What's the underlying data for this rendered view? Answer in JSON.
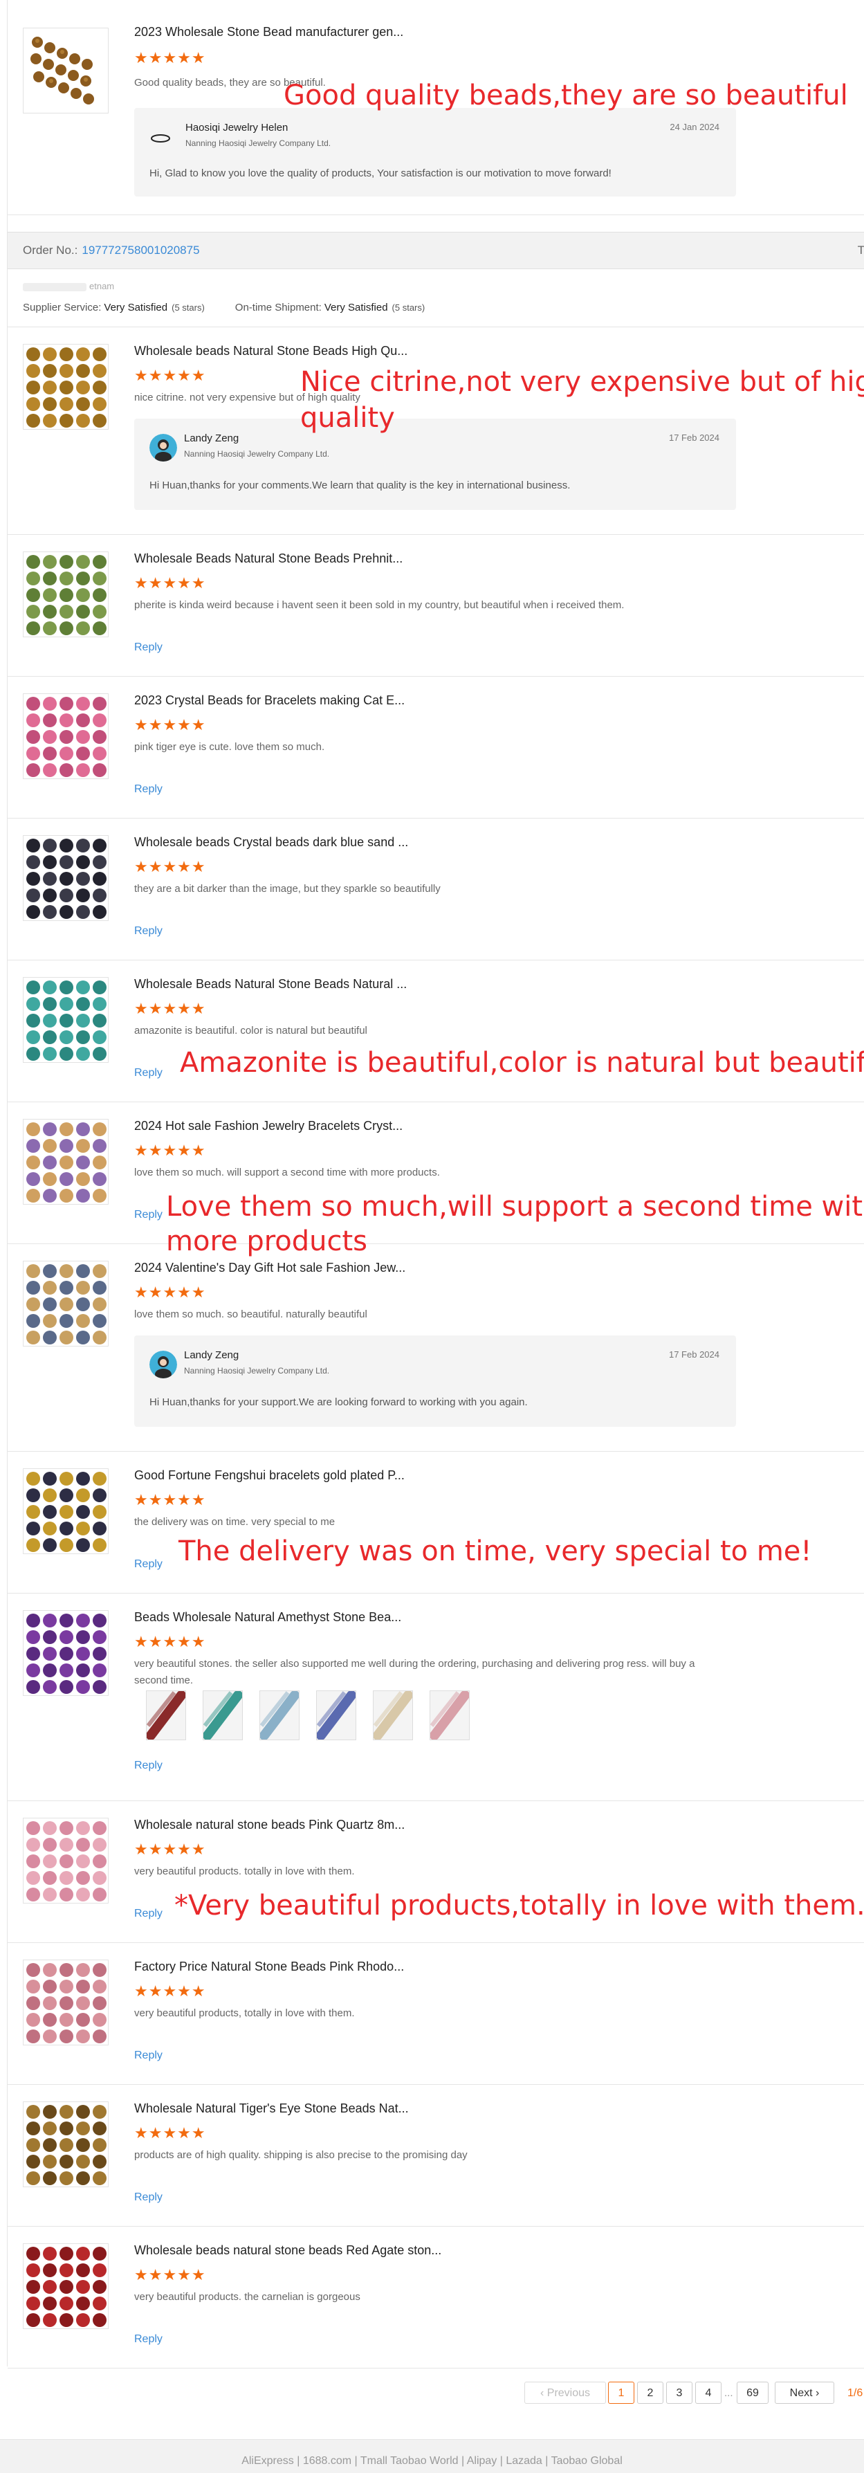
{
  "order1": {
    "item": {
      "title": "2023 Wholesale Stone Bead manufacturer gen...",
      "stars": "★★★★★",
      "comment": "Good quality beads, they are so beautiful.",
      "reply": {
        "name": "Haosiqi Jewelry Helen",
        "company": "Nanning Haosiqi Jewelry Company Ltd.",
        "date": "24 Jan 2024",
        "text": "Hi,  Glad to know you love the quality of products, Your satisfaction is our motivation to move forward!"
      }
    },
    "annotation": "Good quality beads,they are so beautiful"
  },
  "order2": {
    "order_no_label": "Order No.:",
    "order_no": "197772758001020875",
    "right_label": "T",
    "country": "etnam",
    "supplier_service_label": "Supplier Service:",
    "supplier_service_value": "Very Satisfied",
    "supplier_service_stars": "(5 stars)",
    "shipment_label": "On-time Shipment:",
    "shipment_value": "Very Satisfied",
    "shipment_stars": "(5 stars)"
  },
  "items": [
    {
      "title": "Wholesale beads Natural Stone Beads High Qu...",
      "stars": "★★★★★",
      "comment": "nice citrine. not very expensive but of high quality",
      "reply": {
        "name": "Landy Zeng",
        "company": "Nanning Haosiqi Jewelry Company Ltd.",
        "date": "17 Feb 2024",
        "text": "Hi Huan,thanks for your comments.We learn that quality is the key in international business."
      }
    },
    {
      "title": "Wholesale Beads Natural Stone Beads Prehnit...",
      "stars": "★★★★★",
      "comment": "pherite is kinda weird because i havent seen it been sold in my country, but beautiful when i received them.",
      "reply_label": "Reply"
    },
    {
      "title": "2023 Crystal Beads for Bracelets making Cat E...",
      "stars": "★★★★★",
      "comment": "pink tiger eye is cute. love them so much.",
      "reply_label": "Reply"
    },
    {
      "title": "Wholesale beads Crystal beads dark blue sand ...",
      "stars": "★★★★★",
      "comment": "they are a bit darker than the image, but they sparkle so beautifully",
      "reply_label": "Reply"
    },
    {
      "title": "Wholesale Beads Natural Stone Beads Natural ...",
      "stars": "★★★★★",
      "comment": "amazonite is beautiful. color is natural but beautiful",
      "reply_label": "Reply"
    },
    {
      "title": "2024 Hot sale Fashion Jewelry Bracelets Cryst...",
      "stars": "★★★★★",
      "comment": "love them so much. will support a second time with more products.",
      "reply_label": "Reply"
    },
    {
      "title": "2024 Valentine's Day Gift Hot sale Fashion Jew...",
      "stars": "★★★★★",
      "comment": "love them so much. so beautiful. naturally beautiful",
      "reply": {
        "name": "Landy Zeng",
        "company": "Nanning Haosiqi Jewelry Company Ltd.",
        "date": "17 Feb 2024",
        "text": "Hi Huan,thanks for your support.We are looking forward to working with you again."
      }
    },
    {
      "title": "Good Fortune Fengshui bracelets gold plated P...",
      "stars": "★★★★★",
      "comment": "the delivery was on time. very  special to me",
      "reply_label": "Reply"
    },
    {
      "title": "Beads Wholesale Natural Amethyst Stone Bea...",
      "stars": "★★★★★",
      "comment": "very beautiful stones. the seller also supported me well during the ordering, purchasing and delivering prog ress. will buy a second time.",
      "reply_label": "Reply"
    },
    {
      "title": "Wholesale natural stone beads Pink Quartz 8m...",
      "stars": "★★★★★",
      "comment": "very beautiful products. totally in love with them.",
      "reply_label": "Reply"
    },
    {
      "title": "Factory Price Natural Stone Beads Pink Rhodo...",
      "stars": "★★★★★",
      "comment": "very beautiful products, totally in love with them.",
      "reply_label": "Reply"
    },
    {
      "title": "Wholesale Natural Tiger's Eye Stone Beads Nat...",
      "stars": "★★★★★",
      "comment": "products are of high quality. shipping is also precise to the promising day",
      "reply_label": "Reply"
    },
    {
      "title": "Wholesale beads natural stone beads Red Agate ston...",
      "stars": "★★★★★",
      "comment": "very beautiful products. the carnelian is gorgeous",
      "reply_label": "Reply"
    }
  ],
  "annotations": {
    "citrine": "Nice citrine,not very expensive but of high",
    "citrine2": "quality",
    "amazonite": "Amazonite is beautiful,color is natural but beautiful",
    "support1": "Love them so much,will support a second time with",
    "support2": "more products",
    "delivery": "The delivery was on time, very special to me!",
    "beautiful": "*Very beautiful products,totally in love with them."
  },
  "pagination": {
    "previous": "Previous",
    "pages": [
      "1",
      "2",
      "3",
      "4"
    ],
    "ellipsis": "...",
    "last": "69",
    "next": "Next",
    "count": "1/6"
  },
  "footer": "AliExpress | 1688.com | Tmall Taobao World | Alipay | Lazada | Taobao Global",
  "colors": {
    "star": "#f26b0f",
    "link": "#3a8ad6",
    "annotation": "#e8282b"
  }
}
